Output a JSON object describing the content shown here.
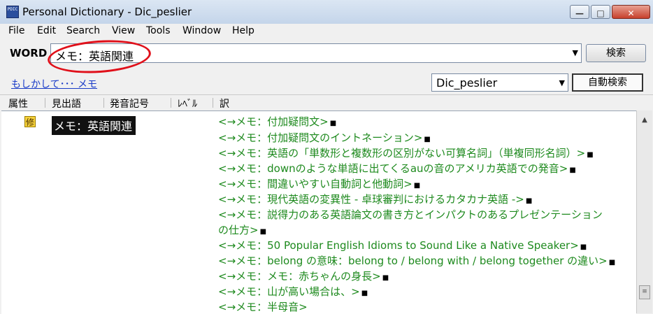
{
  "window": {
    "icon_text": "PDIC",
    "title": "Personal Dictionary - Dic_peslier",
    "min_icon": "minimize-icon",
    "max_icon": "maximize-icon",
    "close_icon": "close-icon"
  },
  "menu": [
    "File",
    "Edit",
    "Search",
    "View",
    "Tools",
    "Window",
    "Help"
  ],
  "search": {
    "label": "WORD",
    "value": "メモ：英語関連",
    "button": "検索"
  },
  "suggest": "もしかして･･･ メモ",
  "dictionary": {
    "selected": "Dic_peslier",
    "auto_button": "自動検索"
  },
  "columns": [
    "属性",
    "見出語",
    "発音記号",
    "ﾚﾍﾞﾙ",
    "訳"
  ],
  "entry": {
    "attr_badge": "修",
    "headword": "メモ：英語関連",
    "refs": [
      "<→メモ：付加疑問文>",
      "<→メモ：付加疑問文のイントネーション>",
      "<→メモ：英語の「単数形と複数形の区別がない可算名詞」（単複同形名詞）>",
      "<→メモ：downのような単語に出てくるauの音のアメリカ英語での発音>",
      "<→メモ：間違いやすい自動詞と他動詞>",
      "<→メモ：現代英語の変異性 - 卓球審判におけるカタカナ英語 ->",
      "<→メモ：説得力のある英語論文の書き方とインパクトのあるプレゼンテーション",
      "の仕方>",
      "<→メモ：50 Popular English Idioms to Sound Like a Native Speaker>",
      "<→メモ：belong の意味：belong to / belong with / belong together の違い>",
      "<→メモ：メモ：赤ちゃんの身長>",
      "<→メモ：山が高い場合は、>",
      "<→メモ：半母音>"
    ],
    "ref_marker": "■"
  },
  "colors": {
    "link_green": "#1e8a1e",
    "highlight_red": "#e0101a",
    "suggest_blue": "#1a3cc8"
  }
}
